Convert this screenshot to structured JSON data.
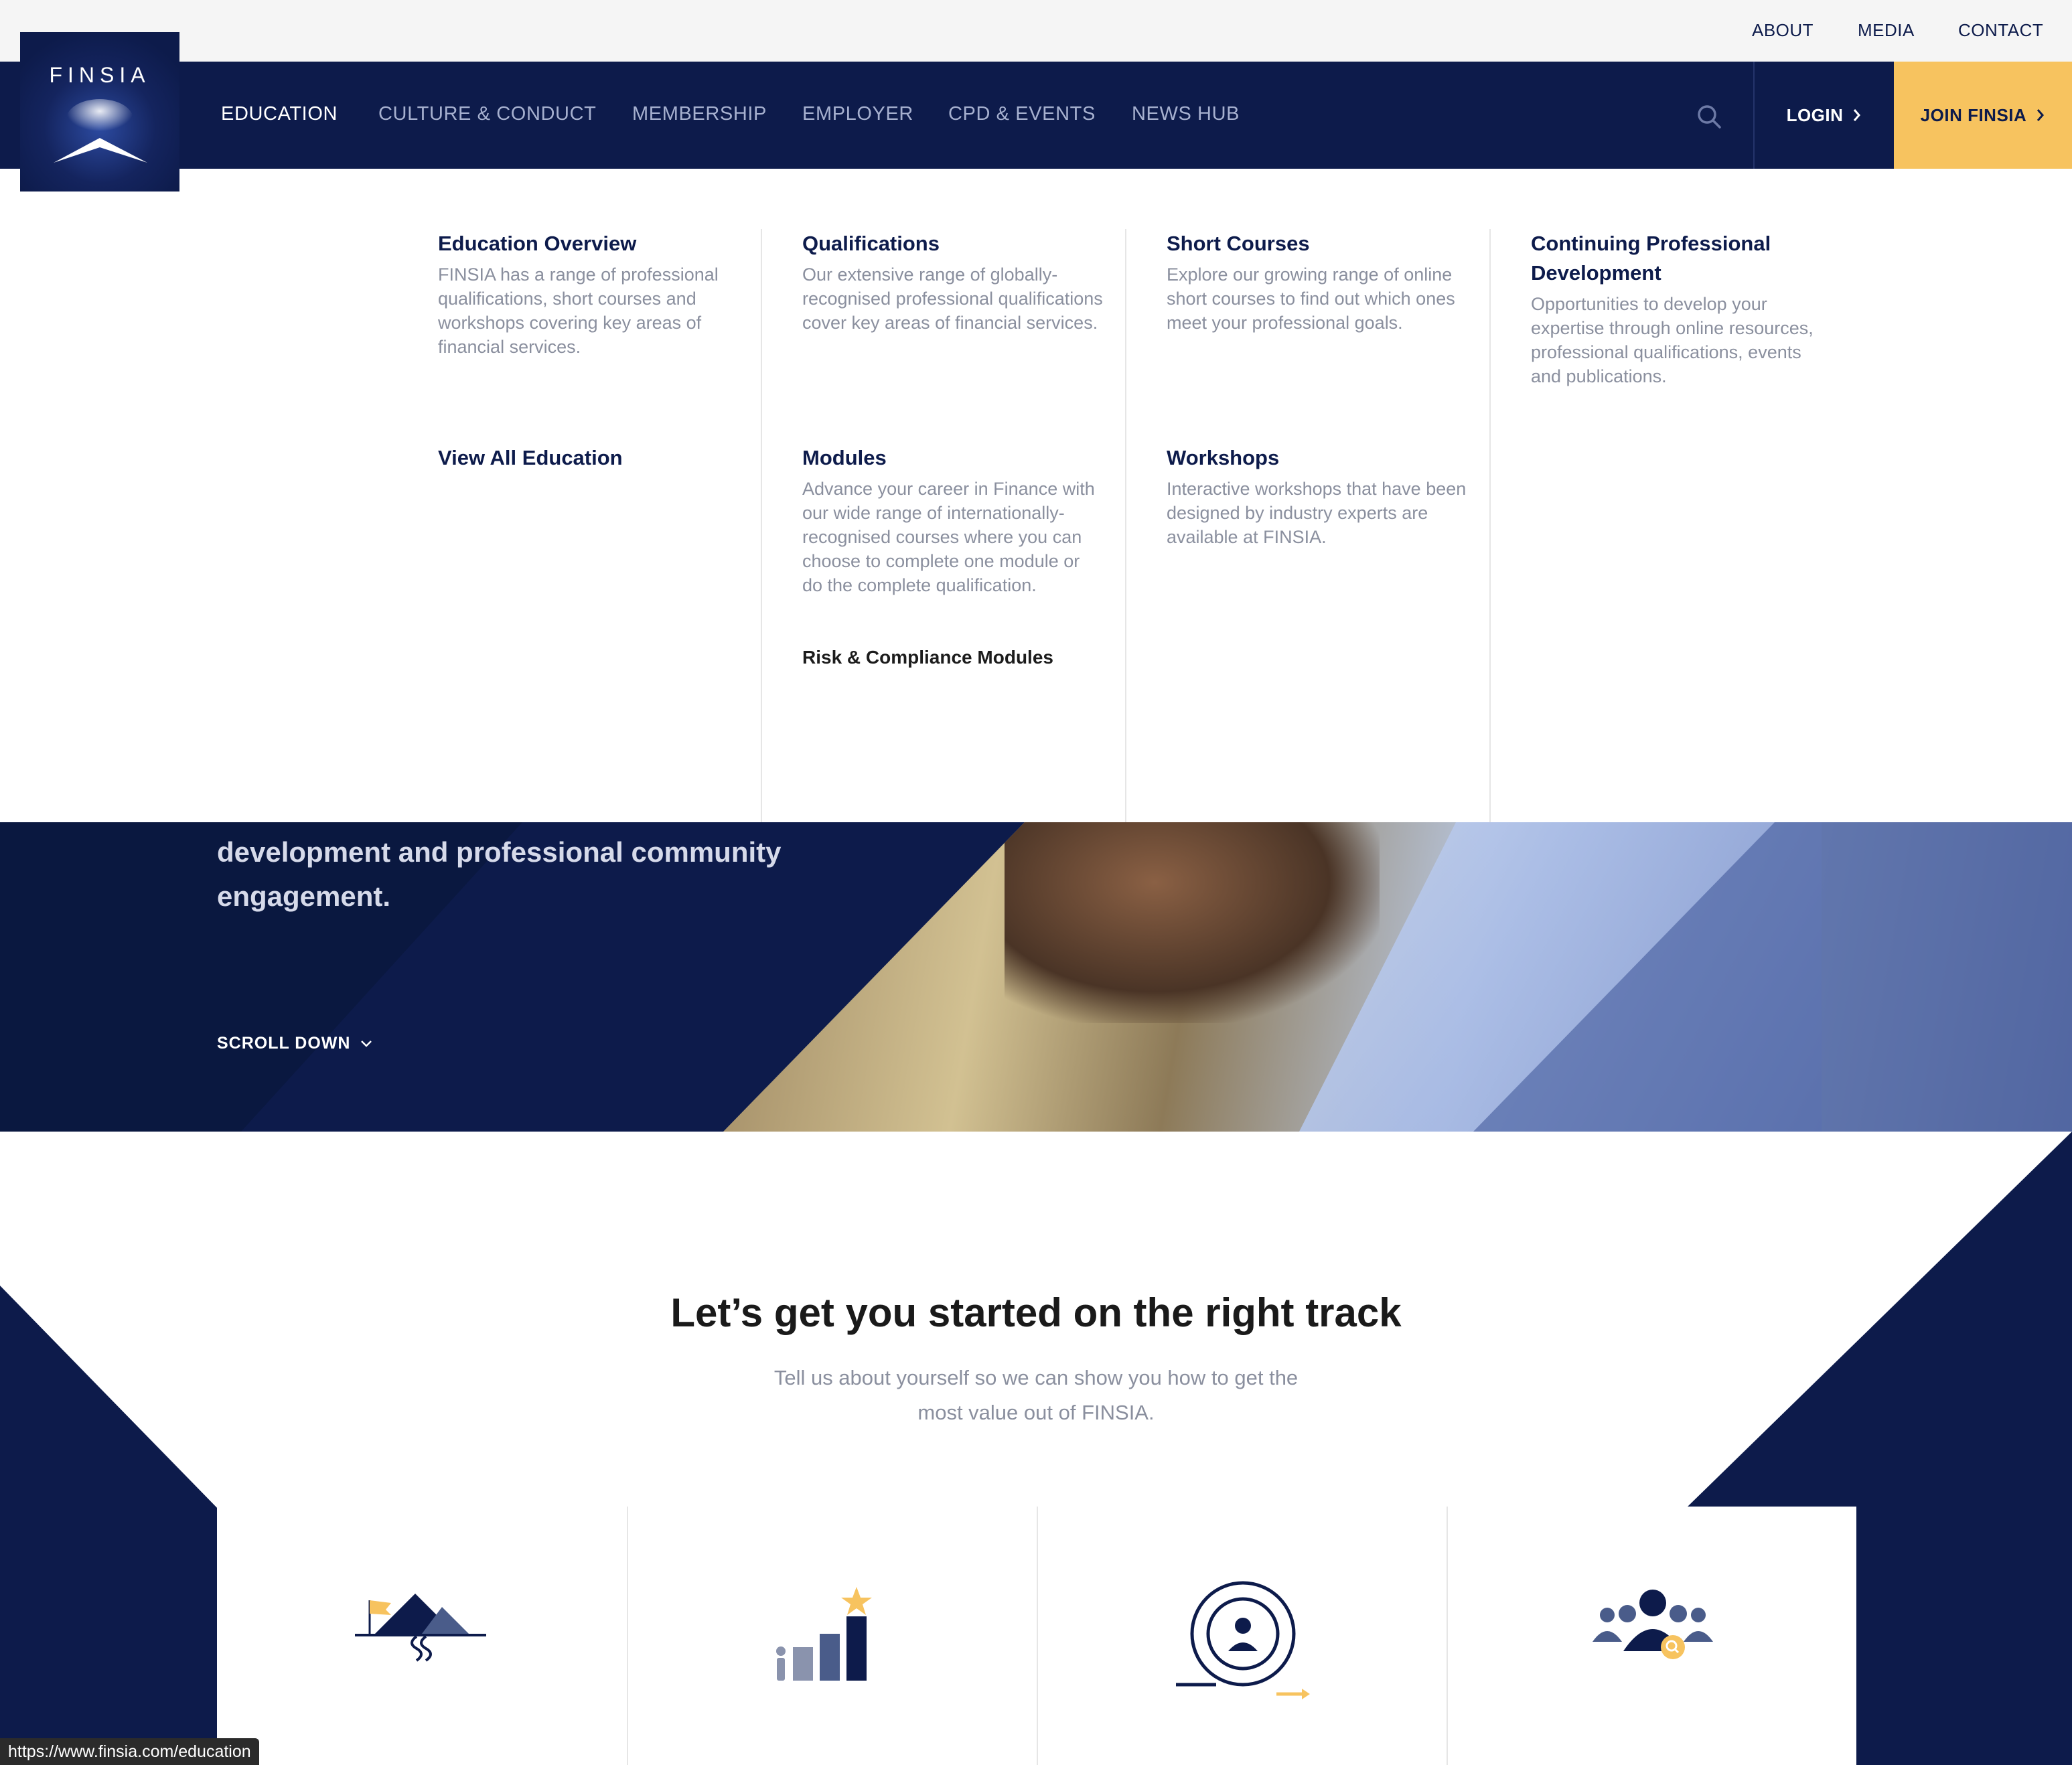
{
  "utility_nav": [
    "ABOUT",
    "MEDIA",
    "CONTACT"
  ],
  "logo": {
    "text": "FINSIA"
  },
  "main_nav": {
    "items": [
      "EDUCATION",
      "CULTURE & CONDUCT",
      "MEMBERSHIP",
      "EMPLOYER",
      "CPD & EVENTS",
      "NEWS HUB"
    ],
    "active": "EDUCATION",
    "login_label": "LOGIN",
    "join_label": "JOIN FINSIA"
  },
  "mega_menu": {
    "education_overview": {
      "title": "Education Overview",
      "desc": "FINSIA has a range of professional qualifications, short courses and workshops covering key areas of financial services."
    },
    "view_all": "View All Education",
    "qualifications": {
      "title": "Qualifications",
      "desc": "Our extensive range of globally-recognised professional qualifications cover key areas of financial services."
    },
    "modules": {
      "title": "Modules",
      "desc": "Advance your career in Finance with our wide range of internationally-recognised courses where you can choose to complete one module or do the complete qualification.",
      "sublink": "Risk & Compliance Modules"
    },
    "short_courses": {
      "title": "Short Courses",
      "desc": "Explore our growing range of online short courses to find out which ones meet your professional goals."
    },
    "workshops": {
      "title": "Workshops",
      "desc": "Interactive workshops that have been designed by industry experts are available at FINSIA."
    },
    "cpd": {
      "title": "Continuing Professional Development",
      "desc": "Opportunities to develop your expertise through online resources, professional qualifications, events and publications."
    }
  },
  "hero": {
    "text": "development and professional community engagement.",
    "scroll_label": "SCROLL DOWN"
  },
  "section": {
    "heading": "Let’s get you started on the right track",
    "subtext": "Tell us about yourself so we can show you how to get the most value out of FINSIA."
  },
  "cards": [
    {
      "icon": "mountain-flag-icon"
    },
    {
      "icon": "growth-bars-star-icon"
    },
    {
      "icon": "career-cycle-icon"
    },
    {
      "icon": "community-search-icon"
    }
  ],
  "colors": {
    "navy": "#0d1b4b",
    "accent_yellow": "#f7c35f",
    "muted_text": "#8a8f9e"
  },
  "status_bar": {
    "url": "https://www.finsia.com/education"
  }
}
